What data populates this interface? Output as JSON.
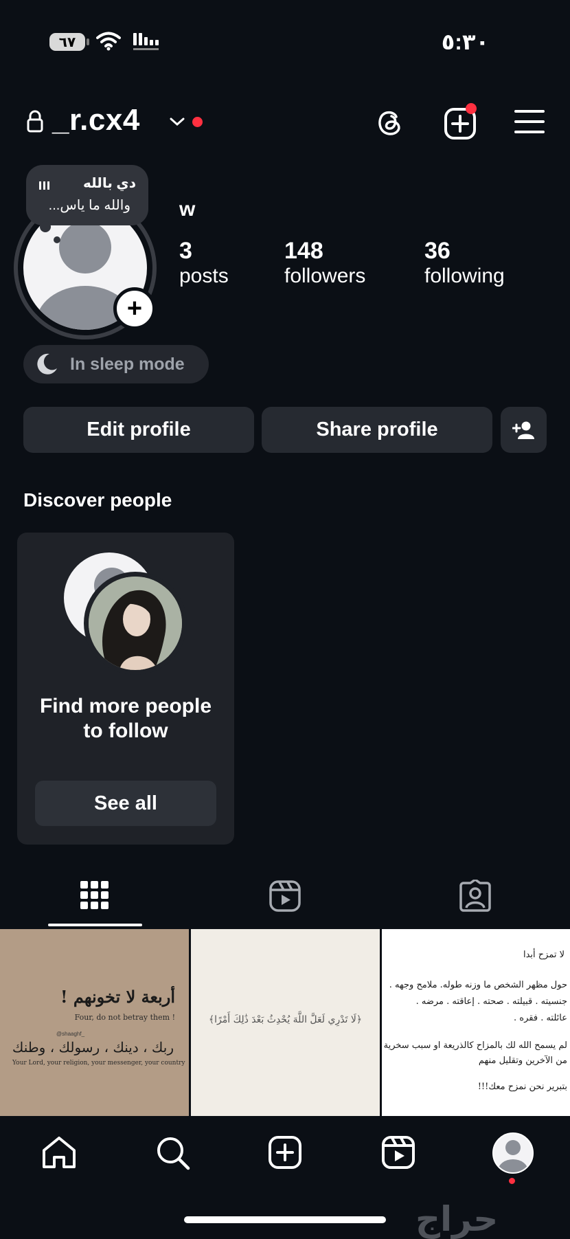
{
  "status_bar": {
    "battery": "٦٧",
    "time": "٥:٣٠",
    "icons": [
      "wifi-icon",
      "cellular-signal-icon"
    ]
  },
  "header": {
    "username": "_r.cx4",
    "icons": [
      "lock-icon",
      "chevron-down-icon",
      "threads-icon",
      "create-post-icon",
      "menu-icon"
    ]
  },
  "profile": {
    "note_line1": "دي بالله",
    "note_line2": "والله ما ياس...",
    "display_name": "w",
    "stats": {
      "posts_count": "3",
      "posts_label": "posts",
      "followers_count": "148",
      "followers_label": "followers",
      "following_count": "36",
      "following_label": "following"
    },
    "sleep_mode": "In sleep mode"
  },
  "actions": {
    "edit_profile": "Edit profile",
    "share_profile": "Share profile"
  },
  "discover": {
    "title": "Discover people",
    "card_text": "Find more people to follow",
    "see_all": "See all"
  },
  "tabs": [
    "grid-icon",
    "reels-icon",
    "tagged-icon"
  ],
  "posts": {
    "post1": {
      "title": "أربعة لا تخونهم !",
      "subtitle": "Four, do not betray them !",
      "handle": "@shaaghf_",
      "line": "ربك ، دينك ، رسولك ، وطنك",
      "line_en": "Your Lord, your religion, your messenger, your country"
    },
    "post2": {
      "verse": "﴿لَا تَدْرِي لَعَلَّ اللَّهَ يُحْدِثُ بَعْدَ ذَٰلِكَ أَمْرًا﴾"
    },
    "post3": {
      "l1": "لا تمزح أبدا",
      "l2": "حول مظهر الشخص ما وزنه طوله. ملامح وجهه .",
      "l3": "جنسيته . قبيلته . صحته . إعاقته . مرضه .",
      "l4": "عائلته . فقره .",
      "l5": "لم يسمح الله لك بالمزاح كالذريعة او سبب سخرية",
      "l6": "من الآخرين وتقليل منهم",
      "l7": "بتبرير نحن نمزح معك!!!"
    }
  },
  "watermark": "حراج",
  "colors": {
    "background": "#0b0f15",
    "button": "#262a31",
    "accent_red": "#ff3040",
    "muted": "#9ea3ab"
  }
}
